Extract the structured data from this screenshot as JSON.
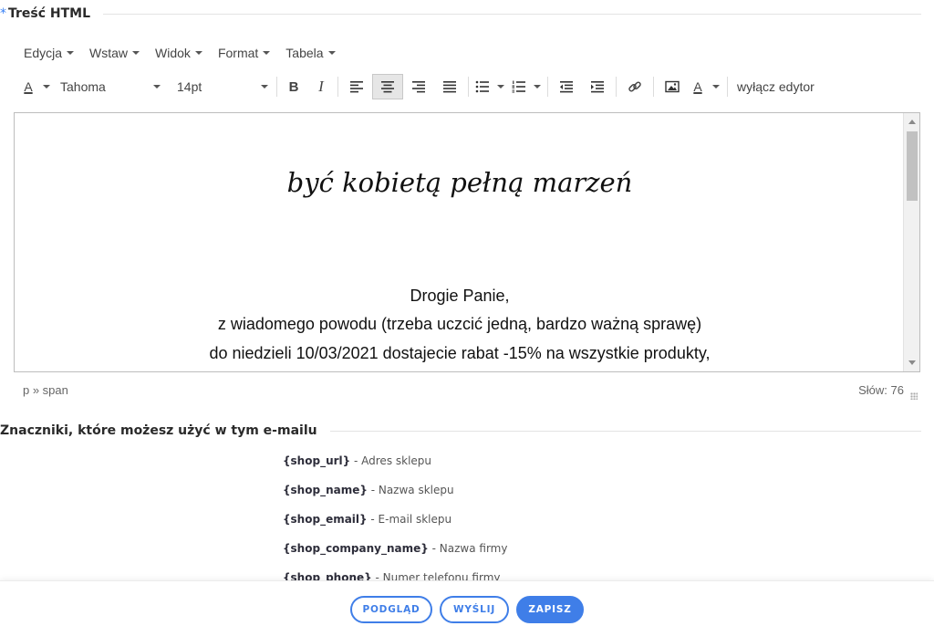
{
  "section_content": {
    "required_mark": "*",
    "title": "Treść HTML"
  },
  "menu": [
    {
      "label": "Edycja"
    },
    {
      "label": "Wstaw"
    },
    {
      "label": "Widok"
    },
    {
      "label": "Format"
    },
    {
      "label": "Tabela"
    }
  ],
  "toolbar": {
    "font_color_label": "A",
    "font_family": "Tahoma",
    "font_size": "14pt",
    "bold_label": "B",
    "italic_label": "I",
    "text_color_label": "A",
    "disable_editor_label": "wyłącz edytor",
    "active_alignment": "center"
  },
  "editor": {
    "logo_text": "być kobietą pełną marzeń",
    "lines": [
      "Drogie Panie,",
      "z wiadomego powodu (trzeba uczcić jedną, bardzo ważną sprawę)",
      "do niedzieli 10/03/2021 dostajecie rabat -15% na wszystkie produkty,"
    ]
  },
  "status": {
    "path": "p » span",
    "word_count": "Słów: 76"
  },
  "section_tags": {
    "title": "Znaczniki, które możesz użyć w tym e-mailu"
  },
  "tags": [
    {
      "tag": "{shop_url}",
      "desc": " - Adres sklepu"
    },
    {
      "tag": "{shop_name}",
      "desc": " - Nazwa sklepu"
    },
    {
      "tag": "{shop_email}",
      "desc": " - E-mail sklepu"
    },
    {
      "tag": "{shop_company_name}",
      "desc": " - Nazwa firmy"
    },
    {
      "tag": "{shop_phone}",
      "desc": " - Numer telefonu firmy"
    }
  ],
  "buttons": {
    "preview": "PODGLĄD",
    "send": "WYŚLIJ",
    "save": "ZAPISZ"
  },
  "colors": {
    "accent": "#3f7ee8",
    "required": "#3b82f6"
  }
}
